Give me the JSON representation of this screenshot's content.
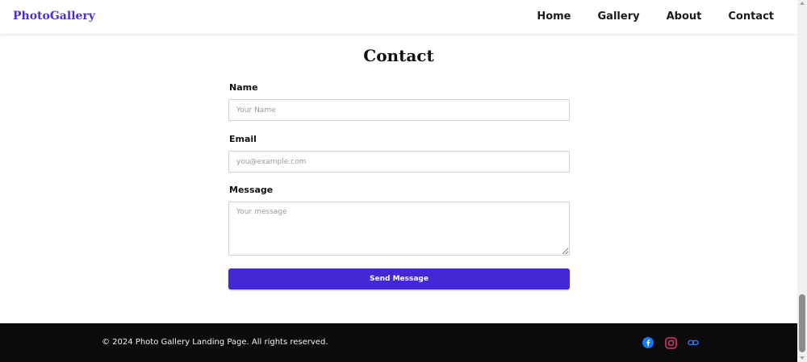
{
  "header": {
    "brand": "PhotoGallery",
    "nav": [
      "Home",
      "Gallery",
      "About",
      "Contact"
    ]
  },
  "contact": {
    "title": "Contact",
    "name_label": "Name",
    "name_placeholder": "Your Name",
    "email_label": "Email",
    "email_placeholder": "you@example.com",
    "message_label": "Message",
    "message_placeholder": "Your message",
    "submit_label": "Send Message"
  },
  "footer": {
    "copyright": "© 2024 Photo Gallery Landing Page. All rights reserved.",
    "socials": [
      "facebook-icon",
      "instagram-icon",
      "link-icon"
    ]
  },
  "colors": {
    "accent": "#4329d4",
    "brand": "#4b2fd4",
    "footer_bg": "#0b0b0b"
  }
}
